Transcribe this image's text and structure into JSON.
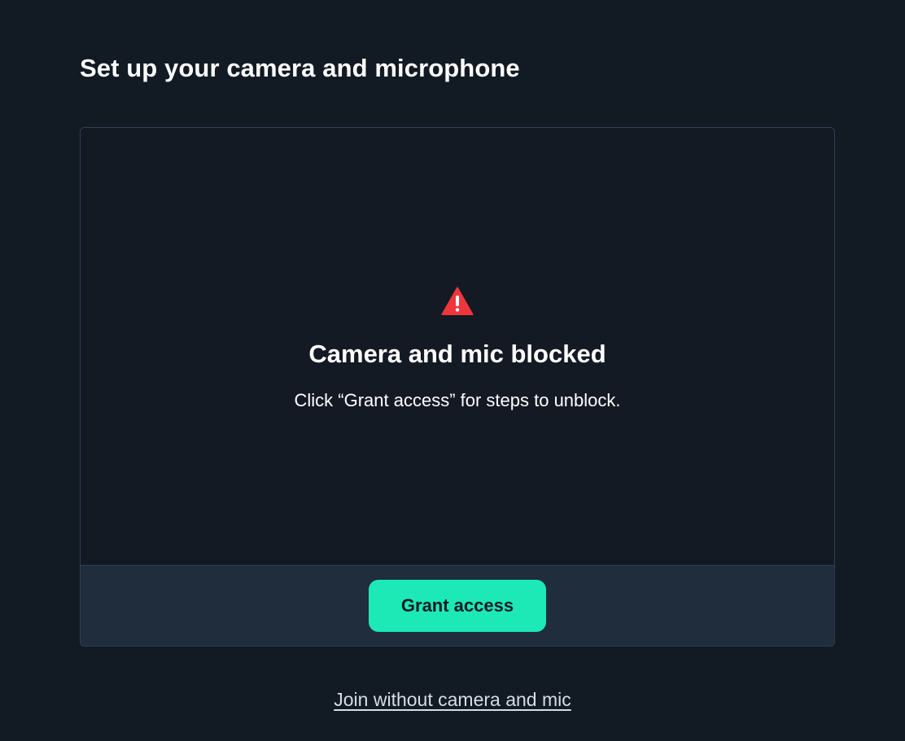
{
  "page": {
    "heading": "Set up your camera and microphone"
  },
  "preview": {
    "status_icon": "warning-triangle-icon",
    "status_color": "#f0353d",
    "title": "Camera and mic blocked",
    "description": "Click “Grant access” for steps to unblock."
  },
  "actions": {
    "grant_access_label": "Grant access",
    "grant_access_color": "#1de9b6",
    "join_without_label": "Join without camera and mic"
  },
  "theme": {
    "background": "#121a24",
    "panel_footer": "#1f2d3d"
  }
}
